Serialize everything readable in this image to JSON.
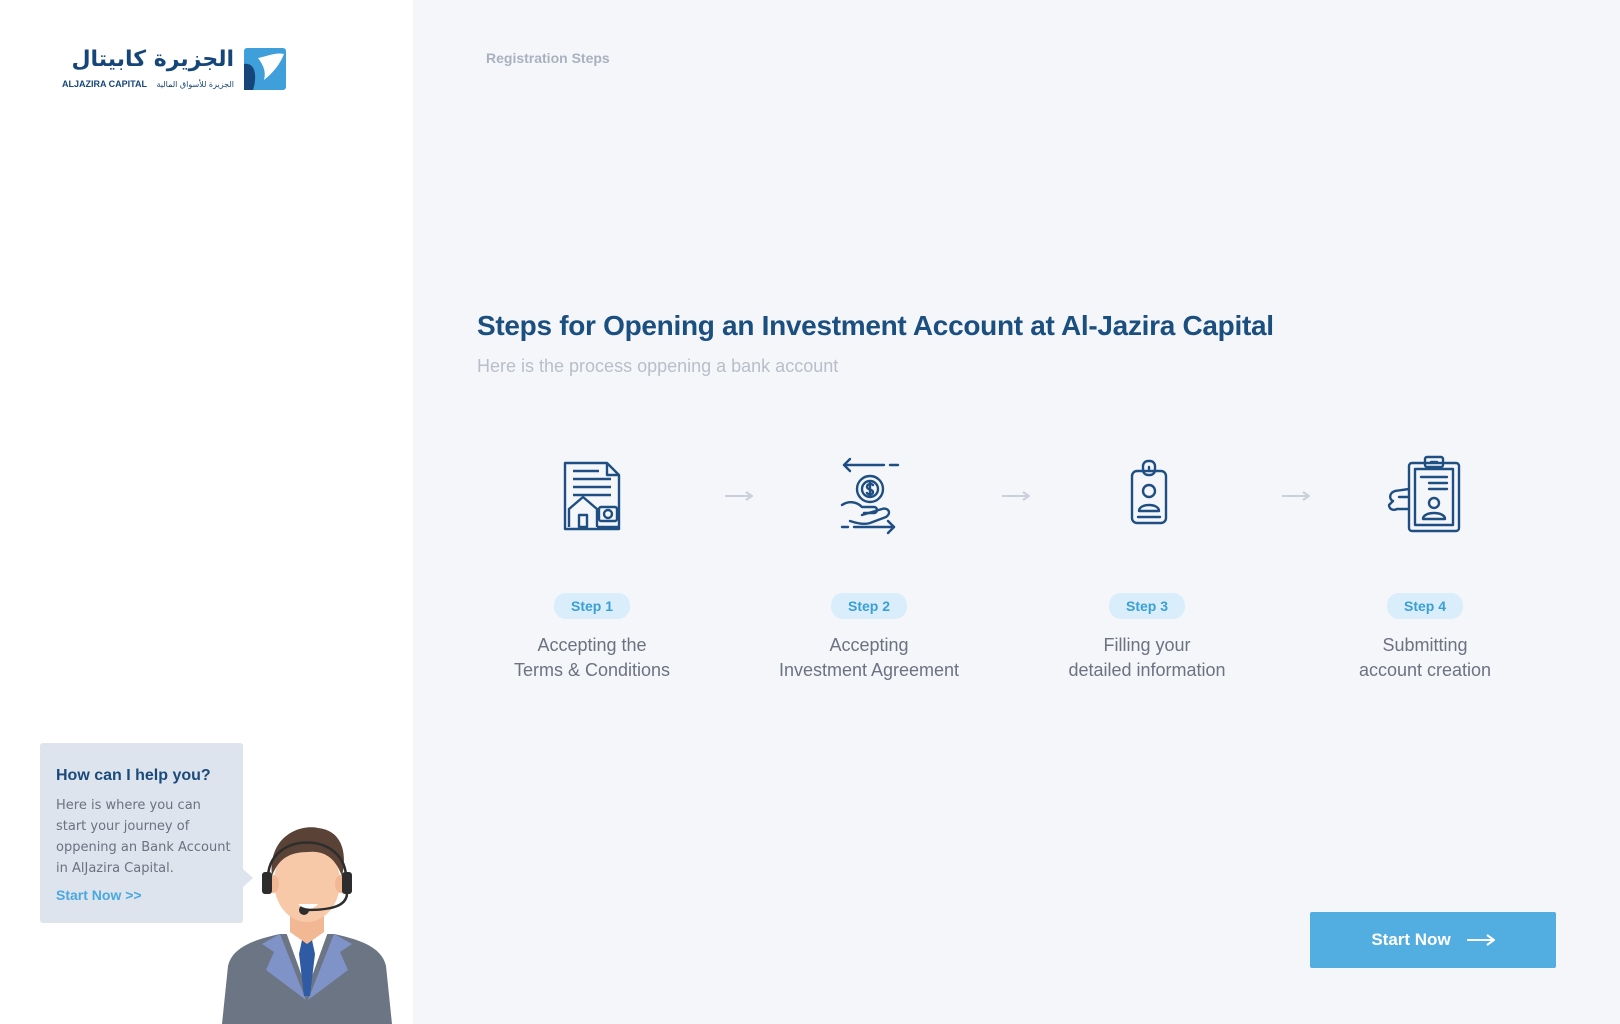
{
  "brand": {
    "arabic_name": "الجزيرة كابيتال",
    "latin_name": "ALJAZIRA CAPITAL",
    "arabic_tagline": "الجزيرة للأسواق المالية"
  },
  "breadcrumb": "Registration Steps",
  "page": {
    "title": "Steps for Opening an Investment Account at Al-Jazira Capital",
    "subtitle": "Here is the process oppening a bank account"
  },
  "steps": [
    {
      "badge": "Step 1",
      "line1": "Accepting the",
      "line2": "Terms & Conditions",
      "icon": "document-house-icon"
    },
    {
      "badge": "Step 2",
      "line1": "Accepting",
      "line2": "Investment Agreement",
      "icon": "hand-money-transfer-icon"
    },
    {
      "badge": "Step 3",
      "line1": "Filling your",
      "line2": "detailed information",
      "icon": "id-badge-icon"
    },
    {
      "badge": "Step 4",
      "line1": "Submitting",
      "line2": "account creation",
      "icon": "clipboard-profile-icon"
    }
  ],
  "help": {
    "title": "How can I help you?",
    "text": "Here is where you can start your journey of oppening an Bank Account in AlJazira Capital.",
    "link": "Start Now >>"
  },
  "cta": {
    "label": "Start Now",
    "icon": "long-arrow-right-icon"
  },
  "colors": {
    "primary": "#1a4f80",
    "accent": "#52ade1",
    "badge_bg": "#d9eefa",
    "help_card_bg": "#dde4ee",
    "background": "#f5f6fa"
  }
}
